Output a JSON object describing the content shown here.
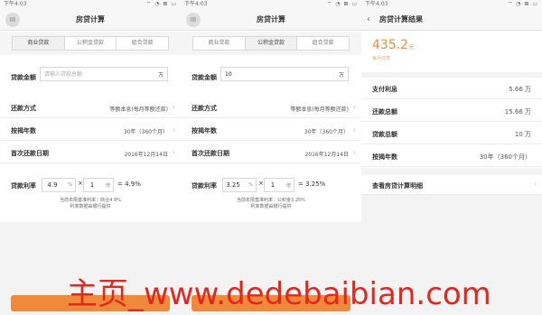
{
  "status": {
    "time": "下午4:03",
    "icons": "⌔ ◔ ⊠ ▭"
  },
  "screen1": {
    "title": "房贷计算",
    "menu_icon": "III",
    "tabs": [
      {
        "label": "商业贷款"
      },
      {
        "label": "公积金贷款"
      },
      {
        "label": "组合贷款"
      }
    ],
    "amount": {
      "label": "贷款金额",
      "value": "",
      "placeholder": "请输入贷款总额",
      "unit": "万"
    },
    "repay_method": {
      "label": "还款方式",
      "value": "等额本息(每月等额还款)"
    },
    "years": {
      "label": "按揭年数",
      "value": "30年（360个月）"
    },
    "first_date": {
      "label": "首次还款日期",
      "value": "2016年12月14日"
    },
    "rate": {
      "label": "贷款利率",
      "base": "4.9",
      "unit": "%",
      "times": "×",
      "mult": "1",
      "mult_unit": "倍",
      "result": "= 4.9%"
    },
    "note_line1": "当前年限基准利率：商业4.9%",
    "note_line2": "利率数据由银行提供"
  },
  "screen2": {
    "title": "房贷计算",
    "menu_icon": "III",
    "tabs": [
      {
        "label": "商业贷款"
      },
      {
        "label": "公积金贷款"
      },
      {
        "label": "组合贷款"
      }
    ],
    "amount": {
      "label": "贷款金额",
      "value": "10",
      "placeholder": "",
      "unit": "万"
    },
    "repay_method": {
      "label": "还款方式",
      "value": "等额本息(每月等额还款)"
    },
    "years": {
      "label": "按揭年数",
      "value": "30年（360个月）"
    },
    "first_date": {
      "label": "首次还款日期",
      "value": "2016年12月14日"
    },
    "rate": {
      "label": "贷款利率",
      "base": "3.25",
      "unit": "%",
      "times": "×",
      "mult": "1",
      "mult_unit": "倍",
      "result": "= 3.25%"
    },
    "note_line1": "当前年限基准利率：公积金3.25%",
    "note_line2": "利率数据由银行提供"
  },
  "screen3": {
    "title": "房贷计算结果",
    "back_icon": "‹",
    "monthly": {
      "value": "435.2",
      "unit": "元",
      "caption": "每月还款"
    },
    "rows": [
      {
        "label": "支付利息",
        "value": "5.66 万"
      },
      {
        "label": "还款总额",
        "value": "15.66 万"
      },
      {
        "label": "贷款总额",
        "value": "10 万"
      },
      {
        "label": "按揭年数",
        "value": "30年（360个月）"
      }
    ],
    "detail_link": "查看房贷计算明细"
  },
  "chevron": "›",
  "watermark": "主页_www.dedebaibian.com",
  "colors": {
    "accent": "#f08a3a",
    "watermark": "#e0281e"
  }
}
